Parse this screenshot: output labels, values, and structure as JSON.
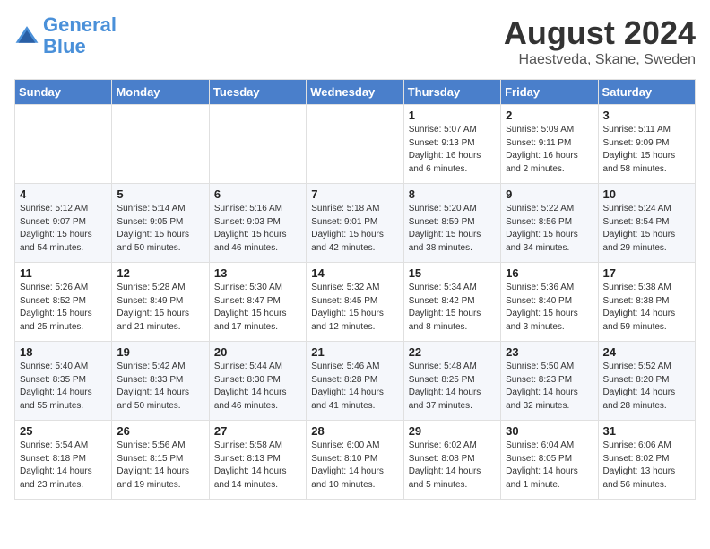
{
  "header": {
    "logo_line1": "General",
    "logo_line2": "Blue",
    "month_year": "August 2024",
    "location": "Haestveda, Skane, Sweden"
  },
  "weekdays": [
    "Sunday",
    "Monday",
    "Tuesday",
    "Wednesday",
    "Thursday",
    "Friday",
    "Saturday"
  ],
  "weeks": [
    [
      {
        "day": "",
        "info": ""
      },
      {
        "day": "",
        "info": ""
      },
      {
        "day": "",
        "info": ""
      },
      {
        "day": "",
        "info": ""
      },
      {
        "day": "1",
        "info": "Sunrise: 5:07 AM\nSunset: 9:13 PM\nDaylight: 16 hours\nand 6 minutes."
      },
      {
        "day": "2",
        "info": "Sunrise: 5:09 AM\nSunset: 9:11 PM\nDaylight: 16 hours\nand 2 minutes."
      },
      {
        "day": "3",
        "info": "Sunrise: 5:11 AM\nSunset: 9:09 PM\nDaylight: 15 hours\nand 58 minutes."
      }
    ],
    [
      {
        "day": "4",
        "info": "Sunrise: 5:12 AM\nSunset: 9:07 PM\nDaylight: 15 hours\nand 54 minutes."
      },
      {
        "day": "5",
        "info": "Sunrise: 5:14 AM\nSunset: 9:05 PM\nDaylight: 15 hours\nand 50 minutes."
      },
      {
        "day": "6",
        "info": "Sunrise: 5:16 AM\nSunset: 9:03 PM\nDaylight: 15 hours\nand 46 minutes."
      },
      {
        "day": "7",
        "info": "Sunrise: 5:18 AM\nSunset: 9:01 PM\nDaylight: 15 hours\nand 42 minutes."
      },
      {
        "day": "8",
        "info": "Sunrise: 5:20 AM\nSunset: 8:59 PM\nDaylight: 15 hours\nand 38 minutes."
      },
      {
        "day": "9",
        "info": "Sunrise: 5:22 AM\nSunset: 8:56 PM\nDaylight: 15 hours\nand 34 minutes."
      },
      {
        "day": "10",
        "info": "Sunrise: 5:24 AM\nSunset: 8:54 PM\nDaylight: 15 hours\nand 29 minutes."
      }
    ],
    [
      {
        "day": "11",
        "info": "Sunrise: 5:26 AM\nSunset: 8:52 PM\nDaylight: 15 hours\nand 25 minutes."
      },
      {
        "day": "12",
        "info": "Sunrise: 5:28 AM\nSunset: 8:49 PM\nDaylight: 15 hours\nand 21 minutes."
      },
      {
        "day": "13",
        "info": "Sunrise: 5:30 AM\nSunset: 8:47 PM\nDaylight: 15 hours\nand 17 minutes."
      },
      {
        "day": "14",
        "info": "Sunrise: 5:32 AM\nSunset: 8:45 PM\nDaylight: 15 hours\nand 12 minutes."
      },
      {
        "day": "15",
        "info": "Sunrise: 5:34 AM\nSunset: 8:42 PM\nDaylight: 15 hours\nand 8 minutes."
      },
      {
        "day": "16",
        "info": "Sunrise: 5:36 AM\nSunset: 8:40 PM\nDaylight: 15 hours\nand 3 minutes."
      },
      {
        "day": "17",
        "info": "Sunrise: 5:38 AM\nSunset: 8:38 PM\nDaylight: 14 hours\nand 59 minutes."
      }
    ],
    [
      {
        "day": "18",
        "info": "Sunrise: 5:40 AM\nSunset: 8:35 PM\nDaylight: 14 hours\nand 55 minutes."
      },
      {
        "day": "19",
        "info": "Sunrise: 5:42 AM\nSunset: 8:33 PM\nDaylight: 14 hours\nand 50 minutes."
      },
      {
        "day": "20",
        "info": "Sunrise: 5:44 AM\nSunset: 8:30 PM\nDaylight: 14 hours\nand 46 minutes."
      },
      {
        "day": "21",
        "info": "Sunrise: 5:46 AM\nSunset: 8:28 PM\nDaylight: 14 hours\nand 41 minutes."
      },
      {
        "day": "22",
        "info": "Sunrise: 5:48 AM\nSunset: 8:25 PM\nDaylight: 14 hours\nand 37 minutes."
      },
      {
        "day": "23",
        "info": "Sunrise: 5:50 AM\nSunset: 8:23 PM\nDaylight: 14 hours\nand 32 minutes."
      },
      {
        "day": "24",
        "info": "Sunrise: 5:52 AM\nSunset: 8:20 PM\nDaylight: 14 hours\nand 28 minutes."
      }
    ],
    [
      {
        "day": "25",
        "info": "Sunrise: 5:54 AM\nSunset: 8:18 PM\nDaylight: 14 hours\nand 23 minutes."
      },
      {
        "day": "26",
        "info": "Sunrise: 5:56 AM\nSunset: 8:15 PM\nDaylight: 14 hours\nand 19 minutes."
      },
      {
        "day": "27",
        "info": "Sunrise: 5:58 AM\nSunset: 8:13 PM\nDaylight: 14 hours\nand 14 minutes."
      },
      {
        "day": "28",
        "info": "Sunrise: 6:00 AM\nSunset: 8:10 PM\nDaylight: 14 hours\nand 10 minutes."
      },
      {
        "day": "29",
        "info": "Sunrise: 6:02 AM\nSunset: 8:08 PM\nDaylight: 14 hours\nand 5 minutes."
      },
      {
        "day": "30",
        "info": "Sunrise: 6:04 AM\nSunset: 8:05 PM\nDaylight: 14 hours\nand 1 minute."
      },
      {
        "day": "31",
        "info": "Sunrise: 6:06 AM\nSunset: 8:02 PM\nDaylight: 13 hours\nand 56 minutes."
      }
    ]
  ]
}
